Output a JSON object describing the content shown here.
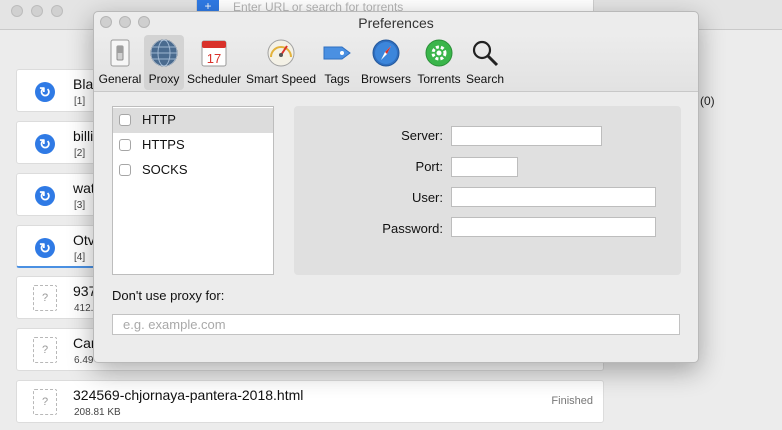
{
  "background_app": {
    "url_bar": {
      "placeholder": "Enter URL or search for torrents"
    },
    "right_count": "(0)",
    "rows": [
      {
        "name": "Bla",
        "sub": "[1]",
        "status": "",
        "kind": "sync"
      },
      {
        "name": "billi",
        "sub": "[2]",
        "status": "",
        "kind": "sync"
      },
      {
        "name": "wat",
        "sub": "[3]",
        "status": "",
        "kind": "sync"
      },
      {
        "name": "Otv",
        "sub": "[4]",
        "status": "",
        "kind": "sync"
      },
      {
        "name": "937",
        "sub": "412.",
        "status": "",
        "kind": "unknown"
      },
      {
        "name": "Car",
        "sub": "6.49",
        "status": "",
        "kind": "unknown"
      },
      {
        "name": "324569-chjornaya-pantera-2018.html",
        "sub": "208.81 KB",
        "status": "Finished",
        "kind": "unknown"
      }
    ]
  },
  "preferences": {
    "title": "Preferences",
    "toolbar": [
      {
        "label": "General",
        "icon": "switch-icon"
      },
      {
        "label": "Proxy",
        "icon": "globe-icon",
        "active": true
      },
      {
        "label": "Scheduler",
        "icon": "calendar-icon",
        "calendar_day": "17"
      },
      {
        "label": "Smart Speed",
        "icon": "speedometer-icon"
      },
      {
        "label": "Tags",
        "icon": "tag-icon"
      },
      {
        "label": "Browsers",
        "icon": "compass-icon"
      },
      {
        "label": "Torrents",
        "icon": "gear-icon"
      },
      {
        "label": "Search",
        "icon": "magnifier-icon"
      }
    ],
    "protocols": [
      {
        "label": "HTTP",
        "checked": false,
        "selected": true
      },
      {
        "label": "HTTPS",
        "checked": false,
        "selected": false
      },
      {
        "label": "SOCKS",
        "checked": false,
        "selected": false
      }
    ],
    "fields": {
      "server_label": "Server:",
      "port_label": "Port:",
      "user_label": "User:",
      "password_label": "Password:",
      "server_value": "",
      "port_value": "",
      "user_value": "",
      "password_value": ""
    },
    "no_proxy": {
      "label": "Don't use proxy for:",
      "placeholder": "e.g. example.com",
      "value": ""
    }
  },
  "colors": {
    "accent": "#2f7ae5",
    "tag_blue": "#4a90e2",
    "torrents_green": "#3ab54a",
    "calendar_red": "#d9322b"
  }
}
